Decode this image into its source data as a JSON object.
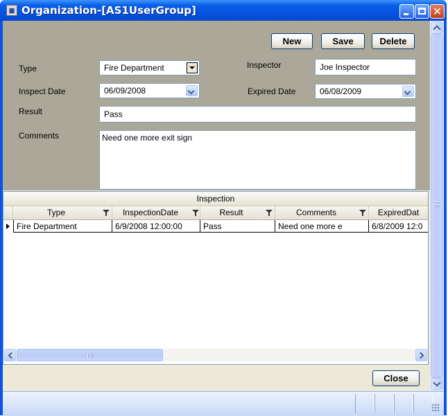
{
  "window": {
    "title": "Organization-[AS1UserGroup]",
    "icon": "form-icon"
  },
  "toolbar": {
    "new_label": "New",
    "save_label": "Save",
    "delete_label": "Delete"
  },
  "form": {
    "type_label": "Type",
    "type_value": "Fire Department",
    "inspector_label": "Inspector",
    "inspector_value": "Joe Inspector",
    "inspect_date_label": "Inspect Date",
    "inspect_date_value": "06/09/2008",
    "expired_date_label": "Expired Date",
    "expired_date_value": "06/08/2009",
    "result_label": "Result",
    "result_value": "Pass",
    "comments_label": "Comments",
    "comments_value": "Need one more exit sign"
  },
  "grid": {
    "group_title": "Inspection",
    "columns": [
      "Type",
      "InspectionDate",
      "Result",
      "Comments",
      "ExpiredDat"
    ],
    "rows": [
      [
        "Fire Department",
        "6/9/2008 12:00:00",
        "Pass",
        "Need one more e",
        "6/8/2009 12:0"
      ]
    ]
  },
  "footer": {
    "close_label": "Close"
  },
  "colors": {
    "title_bar": "#0554e0",
    "form_background": "#aca899",
    "client_background": "#ece9d8"
  }
}
